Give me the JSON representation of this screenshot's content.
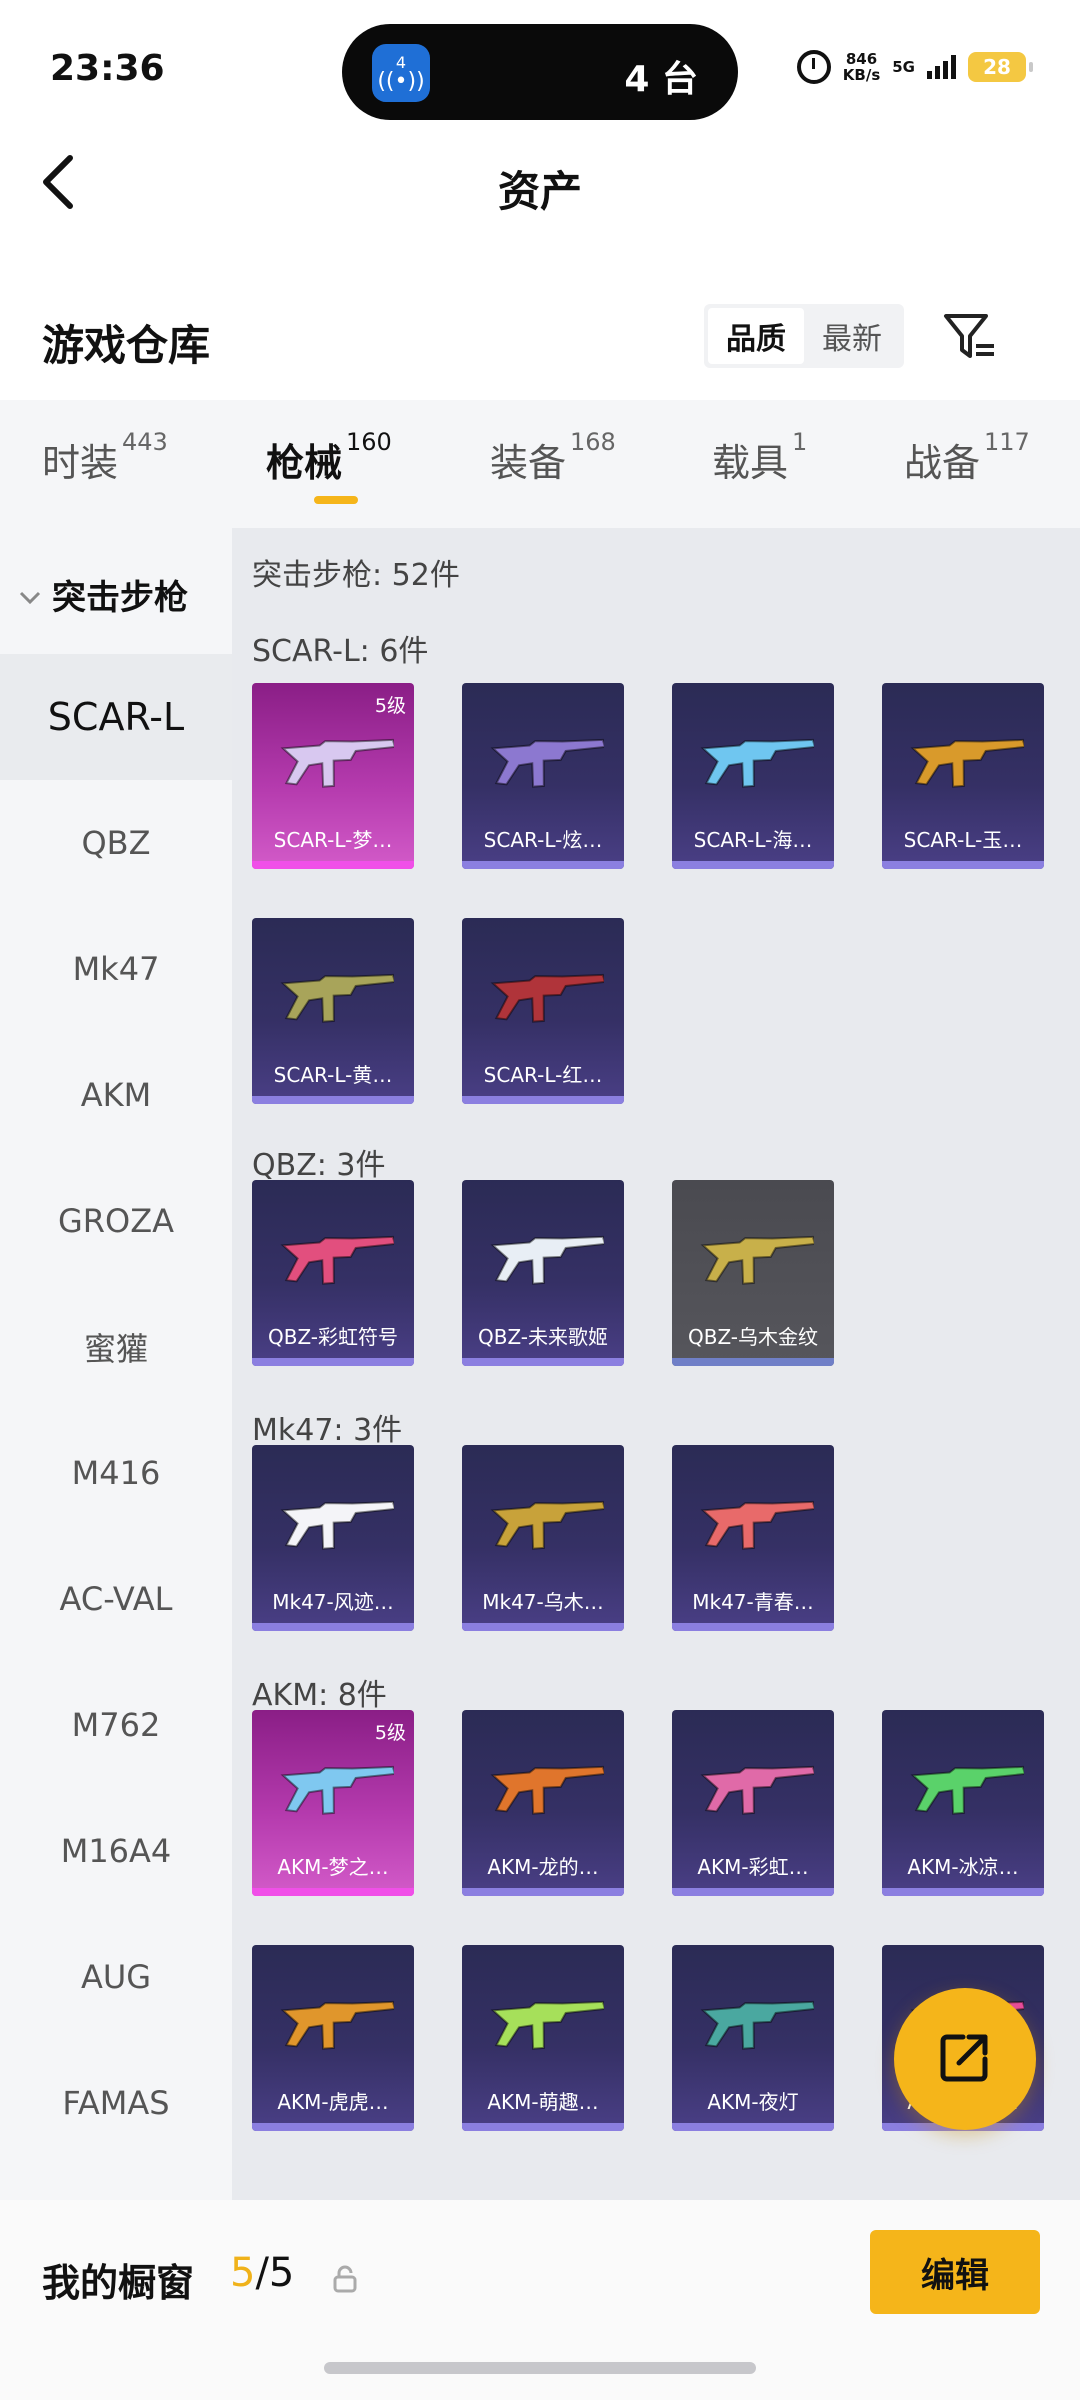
{
  "status_bar": {
    "time": "23:36",
    "island_badge": "4",
    "island_text": "4 台",
    "net_speed": "846",
    "net_unit": "KB/s",
    "net_type": "5G",
    "battery": "28"
  },
  "header": {
    "title": "资产"
  },
  "toolbar": {
    "section_title": "游戏仓库",
    "sort_options": [
      "品质",
      "最新"
    ],
    "sort_selected": "品质"
  },
  "tabs": [
    {
      "label": "时装",
      "count": "443"
    },
    {
      "label": "枪械",
      "count": "160",
      "active": true
    },
    {
      "label": "装备",
      "count": "168"
    },
    {
      "label": "载具",
      "count": "1"
    },
    {
      "label": "战备",
      "count": "117"
    }
  ],
  "sidebar": {
    "category": "突击步枪",
    "items": [
      "SCAR-L",
      "QBZ",
      "Mk47",
      "AKM",
      "GROZA",
      "蜜獾",
      "M416",
      "AC-VAL",
      "M762",
      "M16A4",
      "AUG",
      "FAMAS"
    ],
    "selected": "SCAR-L"
  },
  "content": {
    "heading": "突击步枪: 52件",
    "groups": [
      {
        "title": "SCAR-L: 6件",
        "items": [
          {
            "label": "SCAR-L-梦…",
            "level": "5级",
            "style": "pink",
            "color": "#d8c8f0"
          },
          {
            "label": "SCAR-L-炫…",
            "style": "purple",
            "color": "#8c78d0"
          },
          {
            "label": "SCAR-L-海…",
            "style": "purple",
            "color": "#6fc6f0"
          },
          {
            "label": "SCAR-L-玉…",
            "style": "purple",
            "color": "#d99a2b"
          },
          {
            "label": "SCAR-L-黄…",
            "style": "purple",
            "color": "#a8a45a"
          },
          {
            "label": "SCAR-L-红…",
            "style": "purple",
            "color": "#b0343a"
          }
        ]
      },
      {
        "title": "QBZ: 3件",
        "items": [
          {
            "label": "QBZ-彩虹符号",
            "style": "purple",
            "color": "#e24f7e"
          },
          {
            "label": "QBZ-未来歌姬",
            "style": "purple",
            "color": "#e8eef5"
          },
          {
            "label": "QBZ-乌木金纹",
            "style": "gray",
            "color": "#c8b04a"
          }
        ]
      },
      {
        "title": "Mk47: 3件",
        "items": [
          {
            "label": "Mk47-风迹…",
            "style": "purple",
            "color": "#f4f4f8"
          },
          {
            "label": "Mk47-乌木…",
            "style": "purple",
            "color": "#c8a23a"
          },
          {
            "label": "Mk47-青春…",
            "style": "purple",
            "color": "#e86a6a"
          }
        ]
      },
      {
        "title": "AKM: 8件",
        "items": [
          {
            "label": "AKM-梦之…",
            "level": "5级",
            "style": "pink",
            "color": "#7fc8f0"
          },
          {
            "label": "AKM-龙的…",
            "style": "purple",
            "color": "#e0752c"
          },
          {
            "label": "AKM-彩虹…",
            "style": "purple",
            "color": "#e06aa8"
          },
          {
            "label": "AKM-冰凉…",
            "style": "purple",
            "color": "#5ad26a"
          },
          {
            "label": "AKM-虎虎…",
            "style": "purple",
            "color": "#e0962c"
          },
          {
            "label": "AKM-萌趣…",
            "style": "purple",
            "color": "#a6e05a"
          },
          {
            "label": "AKM-夜灯",
            "style": "purple",
            "color": "#4aa8a0"
          },
          {
            "label": "AKM-霓虹…",
            "style": "purple",
            "color": "#e84aa0"
          }
        ]
      }
    ]
  },
  "bottom_bar": {
    "title": "我的橱窗",
    "count_current": "5",
    "count_separator": "/5",
    "edit_label": "编辑"
  },
  "colors": {
    "accent": "#f5b51a",
    "pink_card": "#b43aad",
    "purple_card": "#353065"
  }
}
